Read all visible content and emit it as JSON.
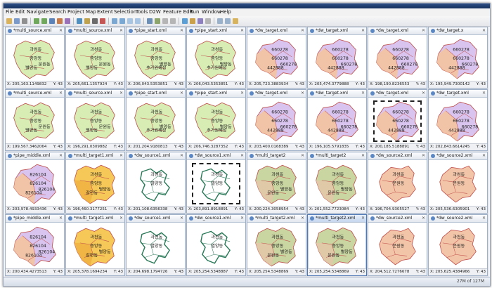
{
  "menu": [
    "File",
    "Edit",
    "Navigate",
    "Search",
    "Project",
    "Map",
    "Extent",
    "Selection",
    "Tools",
    "D2W",
    "Feature Edit",
    "Run",
    "Window",
    "Help"
  ],
  "status_y_label": "Y: 43",
  "memory": "27M of 127M",
  "colors": {
    "orange": "#f7c9a2",
    "green": "#d7edb4",
    "purple": "#d8c4ee",
    "yellow": "#f5c857",
    "olive": "#c9d6a1",
    "peach": "#f3c5a8",
    "pale": "#e7f3d8",
    "white": "#ffffff",
    "border": "#c0504d"
  },
  "cells": [
    {
      "tab": "*multi_source.xml",
      "x": "X: 205,163.1149832",
      "map": "A",
      "active": false,
      "selected": false
    },
    {
      "tab": "*multi_source.xml",
      "x": "X: 205,661.1357924",
      "map": "A",
      "active": false,
      "selected": false
    },
    {
      "tab": "*pipe_start.xml",
      "x": "X: 206,043.5353851",
      "map": "B",
      "active": false,
      "selected": false
    },
    {
      "tab": "*pipe_start.xml",
      "x": "X: 206,043.5353851",
      "map": "B",
      "active": false,
      "selected": false
    },
    {
      "tab": "*dw_target.xml",
      "x": "X: 205,723.3883934",
      "map": "C",
      "active": false,
      "selected": false
    },
    {
      "tab": "*dw_target.xml",
      "x": "X: 205,474.3779888",
      "map": "C",
      "active": false,
      "selected": false
    },
    {
      "tab": "*dw_target.xml",
      "x": "X: 198,190.8236553",
      "map": "C",
      "active": false,
      "selected": false
    },
    {
      "tab": "*dw_target.x",
      "x": "X: 195,949.7300142",
      "map": "C",
      "active": false,
      "selected": false
    },
    {
      "tab": "*multi_source.xml",
      "x": "X: 199,567.3462064",
      "map": "A",
      "active": false,
      "selected": false
    },
    {
      "tab": "*multi_source.xml",
      "x": "X: 196,291.0309882",
      "map": "A",
      "active": false,
      "selected": false
    },
    {
      "tab": "*pipe_start.xml",
      "x": "X: 201,204.9180813",
      "map": "B",
      "active": false,
      "selected": false
    },
    {
      "tab": "*pipe_start.xml",
      "x": "X: 206,746.3287352",
      "map": "B",
      "active": false,
      "selected": false
    },
    {
      "tab": "*dw_target.xml",
      "x": "X: 203,400.0168389",
      "map": "C",
      "active": false,
      "selected": false
    },
    {
      "tab": "*dw_target.xml",
      "x": "X: 196,105.5791835",
      "map": "C",
      "active": false,
      "selected": false
    },
    {
      "tab": "*dw_target.xml",
      "x": "X: 200,185.5188891",
      "map": "C",
      "active": false,
      "selected": true
    },
    {
      "tab": "*dw_target.xml",
      "x": "X: 202,843.6614245",
      "map": "C",
      "active": false,
      "selected": false
    },
    {
      "tab": "*pipe_middle.xml",
      "x": "X: 203,978.4933436",
      "map": "D",
      "active": false,
      "selected": false
    },
    {
      "tab": "*multi_target1.xml",
      "x": "X: 196,460.3177251",
      "map": "E",
      "active": false,
      "selected": false
    },
    {
      "tab": "*dw_source1.xml",
      "x": "X: 201,108.6356338",
      "map": "F",
      "active": false,
      "selected": false
    },
    {
      "tab": "*dw_source1.xml",
      "x": "X: 203,891.8918891",
      "map": "F",
      "active": false,
      "selected": true
    },
    {
      "tab": "*multi_target2",
      "x": "X: 200,224.3058954",
      "map": "G",
      "active": false,
      "selected": false
    },
    {
      "tab": "*multi_target2",
      "x": "X: 201,552.7723084",
      "map": "G",
      "active": false,
      "selected": false
    },
    {
      "tab": "*dw_source2.xml",
      "x": "X: 196,704.9305527",
      "map": "H",
      "active": false,
      "selected": false
    },
    {
      "tab": "*dw_source2.xml",
      "x": "X: 205,536.6305901",
      "map": "H",
      "active": false,
      "selected": false
    },
    {
      "tab": "*pipe_middle.xml",
      "x": "X: 200,434.4273513",
      "map": "D",
      "active": false,
      "selected": false
    },
    {
      "tab": "*multi_target1.xml",
      "x": "X: 205,378.1694234",
      "map": "E",
      "active": false,
      "selected": false
    },
    {
      "tab": "*dw_source1.xml",
      "x": "X: 204,698.1794726",
      "map": "F",
      "active": false,
      "selected": false
    },
    {
      "tab": "*dw_source1.xml",
      "x": "X: 205,254.5348887",
      "map": "F",
      "active": false,
      "selected": false
    },
    {
      "tab": "*multi_target2.xml",
      "x": "X: 205,254.5348869",
      "map": "G",
      "active": false,
      "selected": false
    },
    {
      "tab": "*multi_target2.xml",
      "x": "X: 205,254.5348869",
      "map": "G",
      "active": true,
      "selected": false
    },
    {
      "tab": "*dw_source2.xml",
      "x": "X: 204,512.7276678",
      "map": "H",
      "active": false,
      "selected": false
    },
    {
      "tab": "*dw_source2.xml",
      "x": "X: 205,625.4384966",
      "map": "H",
      "active": false,
      "selected": false
    }
  ],
  "maps": {
    "A": {
      "fill": "green",
      "shape": "m1",
      "labels": [
        "과천동",
        "중앙동",
        "문원동",
        "별양동"
      ]
    },
    "B": {
      "fill": "green",
      "shape": "m1",
      "labels": [
        "과천동",
        "중앙동",
        "별양동",
        "추가원혜성"
      ]
    },
    "C": {
      "fill": "purple",
      "shape": "m2",
      "labels": [
        "660278",
        "660278",
        "660278",
        "442888"
      ]
    },
    "D": {
      "fill": "purple",
      "shape": "m2",
      "labels": [
        "826104",
        "826104",
        "826104",
        "826104"
      ]
    },
    "E": {
      "fill": "yellow",
      "shape": "m1",
      "labels": [
        "과천동",
        "중앙동",
        "별양동",
        "갈현동"
      ]
    },
    "F": {
      "fill": "white",
      "shape": "m3",
      "labels": [
        "과천동",
        "별양동"
      ]
    },
    "G": {
      "fill": "olive",
      "shape": "m1",
      "labels": [
        "과천동",
        "중앙동",
        "별양동",
        "문원동"
      ]
    },
    "H": {
      "fill": "peach",
      "shape": "m4",
      "labels": [
        "과천동",
        "문원동"
      ]
    }
  }
}
